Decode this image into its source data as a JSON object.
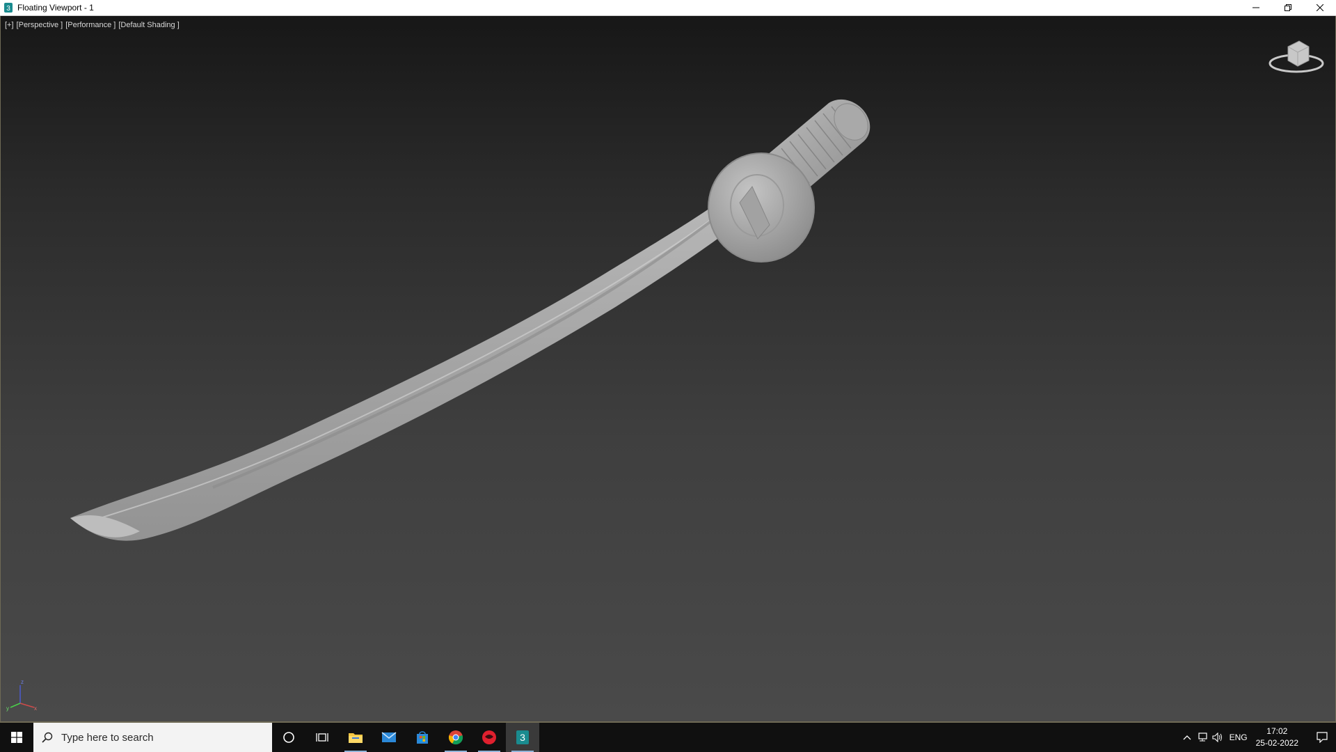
{
  "window": {
    "title": "Floating Viewport - 1"
  },
  "viewport": {
    "labels": [
      "[+]",
      "[Perspective ]",
      "[Performance ]",
      "[Default Shading ]"
    ],
    "axis": {
      "z": "z",
      "x": "x",
      "y": "y"
    }
  },
  "taskbar": {
    "search_placeholder": "Type here to search",
    "apps": [
      "file-explorer",
      "mail",
      "microsoft-store",
      "chrome",
      "red-app",
      "3ds-max"
    ],
    "tray": {
      "language": "ENG",
      "time": "17:02",
      "date": "25-02-2022"
    }
  },
  "colors": {
    "viewport_top": "#171717",
    "viewport_bottom": "#4a4a4a",
    "border": "#6f6a55",
    "model": "#a8a8a8",
    "taskbar": "#101010"
  }
}
